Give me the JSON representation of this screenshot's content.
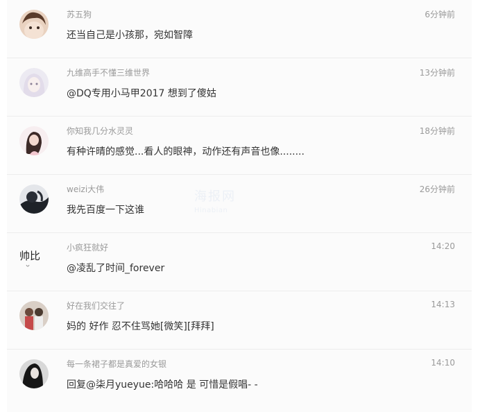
{
  "comments": [
    {
      "user": "苏五狗",
      "time": "6分钟前",
      "text": "还当自己是小孩那，宛如智障"
    },
    {
      "user": "九维高手不懂三维世界",
      "time": "13分钟前",
      "text": "@DQ专用小马甲2017 想到了傻姑"
    },
    {
      "user": "你知我几分水灵灵",
      "time": "18分钟前",
      "text": "有种许晴的感觉...看人的眼神，动作还有声音也像........"
    },
    {
      "user": "weizi大伟",
      "time": "26分钟前",
      "text": "我先百度一下这谁"
    },
    {
      "user": "小疯狂就好",
      "time": "14:20",
      "text": "@凌乱了时间_forever",
      "avatar_text": "帅比"
    },
    {
      "user": "好在我们交往了",
      "time": "14:13",
      "text": "妈的 好作 忍不住骂她[微笑][拜拜]"
    },
    {
      "user": "每一条裙子都是真爱的女银",
      "time": "14:10",
      "text": "回复@柒月yueyue:哈哈哈 是 可惜是假唱- -"
    }
  ],
  "watermark": {
    "cn": "海报网",
    "en": "Hinabian"
  }
}
